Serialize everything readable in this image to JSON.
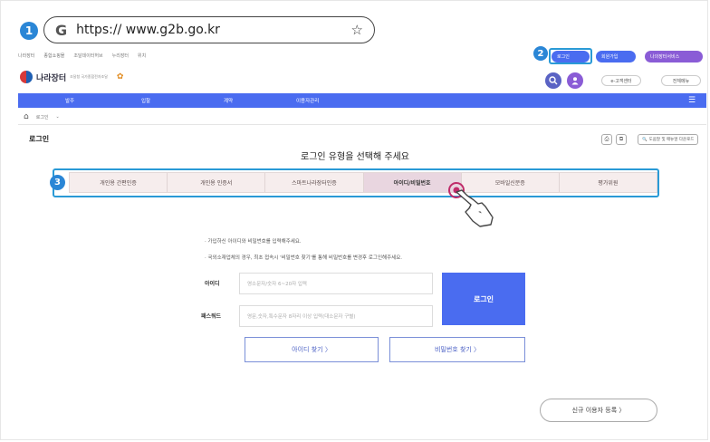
{
  "steps": [
    "1",
    "2",
    "3"
  ],
  "browser": {
    "g_letter": "G",
    "url": "https:// www.g2b.go.kr",
    "star_glyph": "☆"
  },
  "utility_links": [
    "나라장터",
    "종합쇼핑몰",
    "조달데이터허브",
    "누리장터",
    "위치"
  ],
  "header_buttons": {
    "login": "로그인",
    "signup": "회원가입",
    "myg2b": "나의장터서비스"
  },
  "brand": {
    "name": "나라장터",
    "subtitle": "조달청 국가종합전자조달"
  },
  "header_icons": {
    "search": "search-icon",
    "user": "user-icon"
  },
  "header_small": {
    "customer": "e-고객센터",
    "sitemap": "전체메뉴"
  },
  "nav": {
    "items": [
      "발주",
      "입찰",
      "계약",
      "이용자관리"
    ],
    "menu_glyph": "☰"
  },
  "breadcrumb": {
    "home_glyph": "⌂",
    "current": "로그인",
    "chevron": "⌄"
  },
  "page": {
    "title": "로그인",
    "print_glyph": "⎙",
    "share_glyph": "⧉",
    "help_label": "도움말 및 매뉴얼 다운로드",
    "heading": "로그인 유형을 선택해 주세요"
  },
  "tabs": [
    {
      "label": "개인용 간편인증",
      "active": false
    },
    {
      "label": "개인용 인증서",
      "active": false
    },
    {
      "label": "스마트나라장터인증",
      "active": false
    },
    {
      "label": "아이디/비밀번호",
      "active": true
    },
    {
      "label": "모바일신분증",
      "active": false
    },
    {
      "label": "평가위원",
      "active": false
    }
  ],
  "notes": [
    "· 가입하신 아이디와 비밀번호를 입력해주세요.",
    "· 국외소재업체의 경우, 최초 접속시 '비밀번호 찾기'를 통해 비밀번호를 변경후 로그인해주세요."
  ],
  "form": {
    "id_label": "아이디",
    "id_placeholder": "영소문자/숫자 6~20자 입력",
    "pw_label": "패스워드",
    "pw_placeholder": "영문,숫자,특수문자 8자리 이상 입력(대소문자 구별)",
    "login_button": "로그인",
    "find_id": "아이디 찾기 〉",
    "find_pw": "비밀번호 찾기 〉"
  },
  "signup_button": "신규 이용자 등록 〉",
  "colors": {
    "badge_blue": "#2a86d6",
    "nav_blue": "#4a6cf0",
    "tab_bg": "#f6eded",
    "tab_active": "#e9d6e0"
  }
}
